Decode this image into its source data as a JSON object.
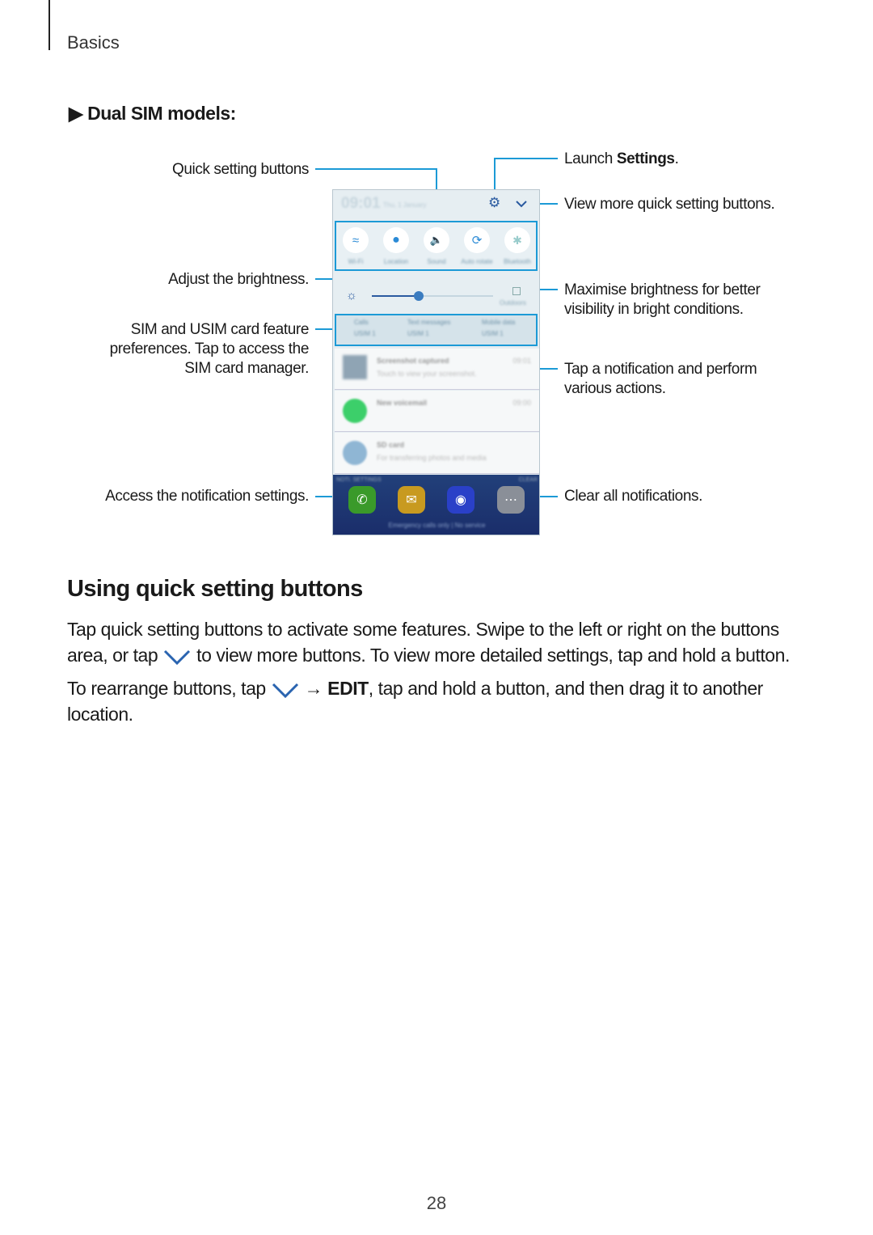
{
  "header": {
    "section": "Basics"
  },
  "subheading": "Dual SIM models:",
  "callouts": {
    "quick_setting_buttons": "Quick setting buttons",
    "adjust_brightness": "Adjust the brightness.",
    "sim_1": "SIM and USIM card feature",
    "sim_2": "preferences. Tap to access the",
    "sim_3": "SIM card manager.",
    "noti_settings": "Access the notification settings.",
    "launch_pre": "Launch ",
    "launch_bold": "Settings",
    "launch_post": ".",
    "view_more": "View more quick setting buttons.",
    "maximise_1": "Maximise brightness for better",
    "maximise_2": "visibility in bright conditions.",
    "tap_notif_1": "Tap a notification and perform",
    "tap_notif_2": "various actions.",
    "clear_all": "Clear all notifications."
  },
  "accent_color": "#1c9ad6",
  "phone": {
    "time": "09:01",
    "date": "Thu, 1 January",
    "quick": [
      {
        "label": "Wi-Fi",
        "icon": "wifi-icon"
      },
      {
        "label": "Location",
        "icon": "location-icon"
      },
      {
        "label": "Sound",
        "icon": "sound-icon"
      },
      {
        "label": "Auto rotate",
        "icon": "rotate-icon"
      },
      {
        "label": "Bluetooth",
        "icon": "bluetooth-icon"
      }
    ],
    "outdoors": "Outdoors",
    "sim": [
      {
        "title": "Calls",
        "value": "USIM 1"
      },
      {
        "title": "Text messages",
        "value": "USIM 1"
      },
      {
        "title": "Mobile data",
        "value": "USIM 1"
      }
    ],
    "notifications": [
      {
        "title": "Screenshot captured",
        "text": "Touch to view your screenshot.",
        "time": "09:01"
      },
      {
        "title": "New voicemail",
        "text": "",
        "time": "09:00"
      },
      {
        "title": "SD card",
        "text": "For transferring photos and media",
        "time": ""
      }
    ],
    "noti_settings": "NOTI. SETTINGS",
    "clear": "CLEAR",
    "status": "Emergency calls only | No service"
  },
  "section_title": "Using quick setting buttons",
  "body": {
    "p1_line1": "Tap quick setting buttons to activate some features. Swipe to the left or right on the buttons",
    "p1_l2_a": "area, or tap",
    "p1_l2_b": "to view more buttons. To view more detailed settings, tap and hold a button.",
    "p2_a": "To rearrange buttons, tap",
    "p2_arrow": "→",
    "p2_bold": "EDIT",
    "p2_b": ", tap and hold a button, and then drag it to another",
    "p2_line2": "location."
  },
  "page_number": "28"
}
